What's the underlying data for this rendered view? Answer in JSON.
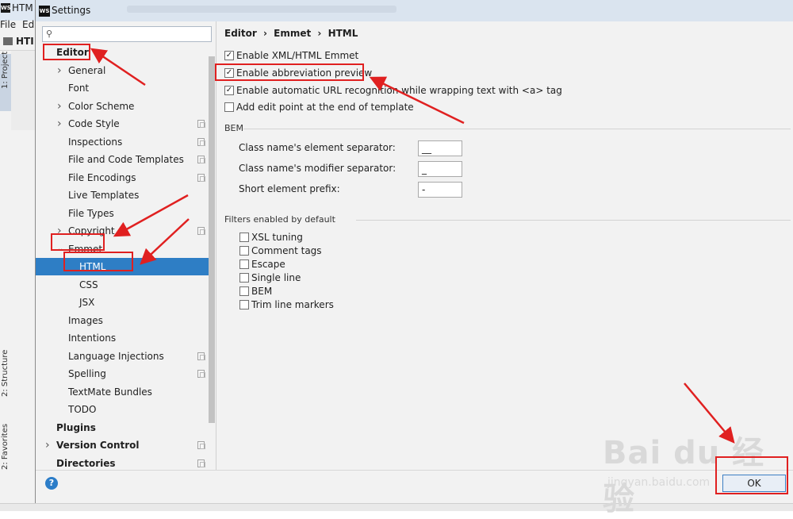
{
  "ide": {
    "title": "HTM",
    "menu": [
      "File",
      "Ed"
    ],
    "breadcrumb": "HTI",
    "vtabs": [
      "1: Project",
      "2: Structure",
      "2: Favorites"
    ]
  },
  "dialog": {
    "title": "Settings"
  },
  "search": {
    "placeholder": ""
  },
  "tree": [
    {
      "label": "Editor",
      "level": 0,
      "bold": true
    },
    {
      "label": "General",
      "level": 1,
      "arrow": "right"
    },
    {
      "label": "Font",
      "level": 1
    },
    {
      "label": "Color Scheme",
      "level": 1,
      "arrow": "right"
    },
    {
      "label": "Code Style",
      "level": 1,
      "arrow": "right",
      "copy": true
    },
    {
      "label": "Inspections",
      "level": 1,
      "copy": true
    },
    {
      "label": "File and Code Templates",
      "level": 1,
      "copy": true
    },
    {
      "label": "File Encodings",
      "level": 1,
      "copy": true
    },
    {
      "label": "Live Templates",
      "level": 1
    },
    {
      "label": "File Types",
      "level": 1
    },
    {
      "label": "Copyright",
      "level": 1,
      "arrow": "right",
      "copy": true
    },
    {
      "label": "Emmet",
      "level": 1,
      "arrow": "down"
    },
    {
      "label": "HTML",
      "level": 2,
      "selected": true
    },
    {
      "label": "CSS",
      "level": 2
    },
    {
      "label": "JSX",
      "level": 2
    },
    {
      "label": "Images",
      "level": 1
    },
    {
      "label": "Intentions",
      "level": 1
    },
    {
      "label": "Language Injections",
      "level": 1,
      "copy": true
    },
    {
      "label": "Spelling",
      "level": 1,
      "copy": true
    },
    {
      "label": "TextMate Bundles",
      "level": 1
    },
    {
      "label": "TODO",
      "level": 1
    },
    {
      "label": "Plugins",
      "level": 0,
      "bold": true
    },
    {
      "label": "Version Control",
      "level": 0,
      "bold": true,
      "arrow": "right",
      "copy": true
    },
    {
      "label": "Directories",
      "level": 0,
      "bold": true,
      "copy": true
    }
  ],
  "breadcrumb": [
    "Editor",
    "›",
    "Emmet",
    "›",
    "HTML"
  ],
  "options": [
    {
      "label": "Enable XML/HTML Emmet",
      "checked": true
    },
    {
      "label": "Enable abbreviation preview",
      "checked": true
    },
    {
      "label": "Enable automatic URL recognition while wrapping text with <a> tag",
      "checked": true
    },
    {
      "label": "Add edit point at the end of template",
      "checked": false
    }
  ],
  "bem": {
    "title": "BEM",
    "fields": [
      {
        "label": "Class name's element separator:",
        "value": "__"
      },
      {
        "label": "Class name's modifier separator:",
        "value": "_"
      },
      {
        "label": "Short element prefix:",
        "value": "-"
      }
    ]
  },
  "filters": {
    "title": "Filters enabled by default",
    "items": [
      {
        "label": "XSL tuning",
        "checked": false
      },
      {
        "label": "Comment tags",
        "checked": false
      },
      {
        "label": "Escape",
        "checked": false
      },
      {
        "label": "Single line",
        "checked": false
      },
      {
        "label": "BEM",
        "checked": false
      },
      {
        "label": "Trim line markers",
        "checked": false
      }
    ]
  },
  "footer": {
    "help": "?",
    "ok": "OK"
  },
  "watermark": {
    "main": "Bai du 经验",
    "sub": "jingyan.baidu.com"
  },
  "colors": {
    "accent": "#2e7ec5",
    "annotation": "#e02020",
    "panel": "#f2f2f2"
  }
}
